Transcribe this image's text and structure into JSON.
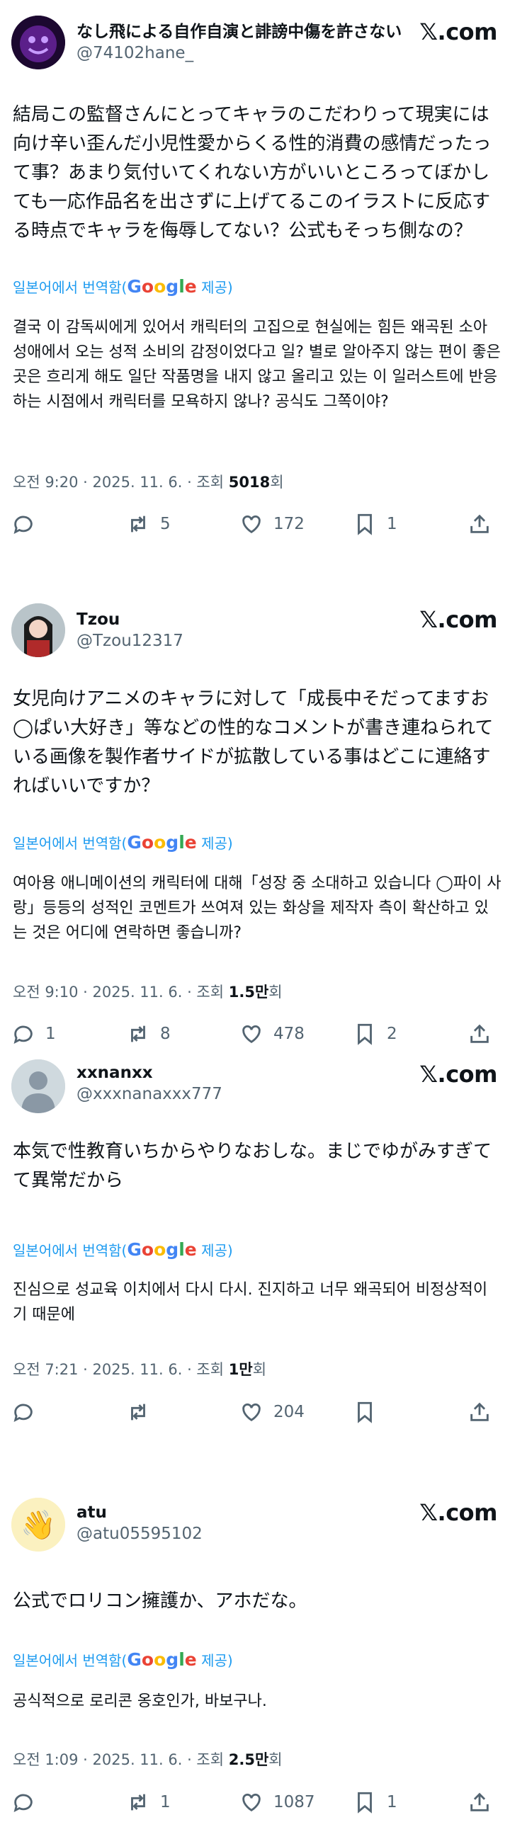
{
  "brand": {
    "logo_x": "𝕏",
    "logo_com": ".com",
    "accent": "#1d9bf0"
  },
  "translate": {
    "prefix": "일본어에서 번역함(",
    "google": [
      "G",
      "o",
      "o",
      "g",
      "l",
      "e"
    ],
    "suffix": " 제공)"
  },
  "posts": [
    {
      "display_name": "なし飛による自作自演と誹謗中傷を許さない",
      "handle": "@74102hane_",
      "avatar": "purple-smiley-avatar",
      "original_text": "結局この監督さんにとってキャラのこだわりって現実には向け辛い歪んだ小児性愛からくる性的消費の感情だったって事？あまり気付いてくれない方がいいところってぼかしても一応作品名を出さずに上げてるこのイラストに反応する時点でキャラを侮辱してない？公式もそっち側なの？",
      "translated_text": "결국 이 감독씨에게 있어서 캐릭터의 고집으로 현실에는 힘든 왜곡된 소아성애에서 오는 성적 소비의 감정이었다고 일? 별로 알아주지 않는 편이 좋은 곳은 흐리게 해도 일단 작품명을 내지 않고 올리고 있는 이 일러스트에 반응하는 시점에서 캐릭터를 모욕하지 않나? 공식도 그쪽이야?",
      "time": "오전 9:20 · 2025. 11. 6. · 조회 ",
      "views": "5018",
      "views_suffix": "회",
      "replies": "",
      "reposts": "5",
      "likes": "172",
      "bookmarks": "1"
    },
    {
      "display_name": "Tzou",
      "handle": "@Tzou12317",
      "avatar": "anime-character-avatar",
      "original_text": "女児向けアニメのキャラに対して「成長中そだってますお◯ぱい大好き」等などの性的なコメントが書き連ねられている画像を製作者サイドが拡散している事はどこに連絡すればいいですか？",
      "translated_text": "여아용 애니메이션의 캐릭터에 대해「성장 중 소대하고 있습니다 ◯파이 사랑」등등의 성적인 코멘트가 쓰여져 있는 화상을 제작자 측이 확산하고 있는 것은 어디에 연락하면 좋습니까?",
      "time": "오전 9:10 · 2025. 11. 6. · 조회 ",
      "views": "1.5만",
      "views_suffix": "회",
      "replies": "1",
      "reposts": "8",
      "likes": "478",
      "bookmarks": "2"
    },
    {
      "display_name": "xxnanxx",
      "handle": "@xxxnanaxxx777",
      "avatar": "default-person-avatar",
      "original_text": "本気で性教育いちからやりなおしな。まじでゆがみすぎてて異常だから",
      "translated_text": "진심으로 성교육 이치에서 다시 다시. 진지하고 너무 왜곡되어 비정상적이기 때문에",
      "time": "오전 7:21 · 2025. 11. 6. · 조회 ",
      "views": "1만",
      "views_suffix": "회",
      "replies": "",
      "reposts": "",
      "likes": "204",
      "bookmarks": ""
    },
    {
      "display_name": "atu",
      "handle": "@atu05595102",
      "avatar": "waving-hand-avatar",
      "original_text": "公式でロリコン擁護か、アホだな。",
      "translated_text": "공식적으로 로리콘 옹호인가, 바보구나.",
      "time": "오전 1:09 · 2025. 11. 6. · 조회 ",
      "views": "2.5만",
      "views_suffix": "회",
      "replies": "",
      "reposts": "1",
      "likes": "1087",
      "bookmarks": "1"
    }
  ]
}
